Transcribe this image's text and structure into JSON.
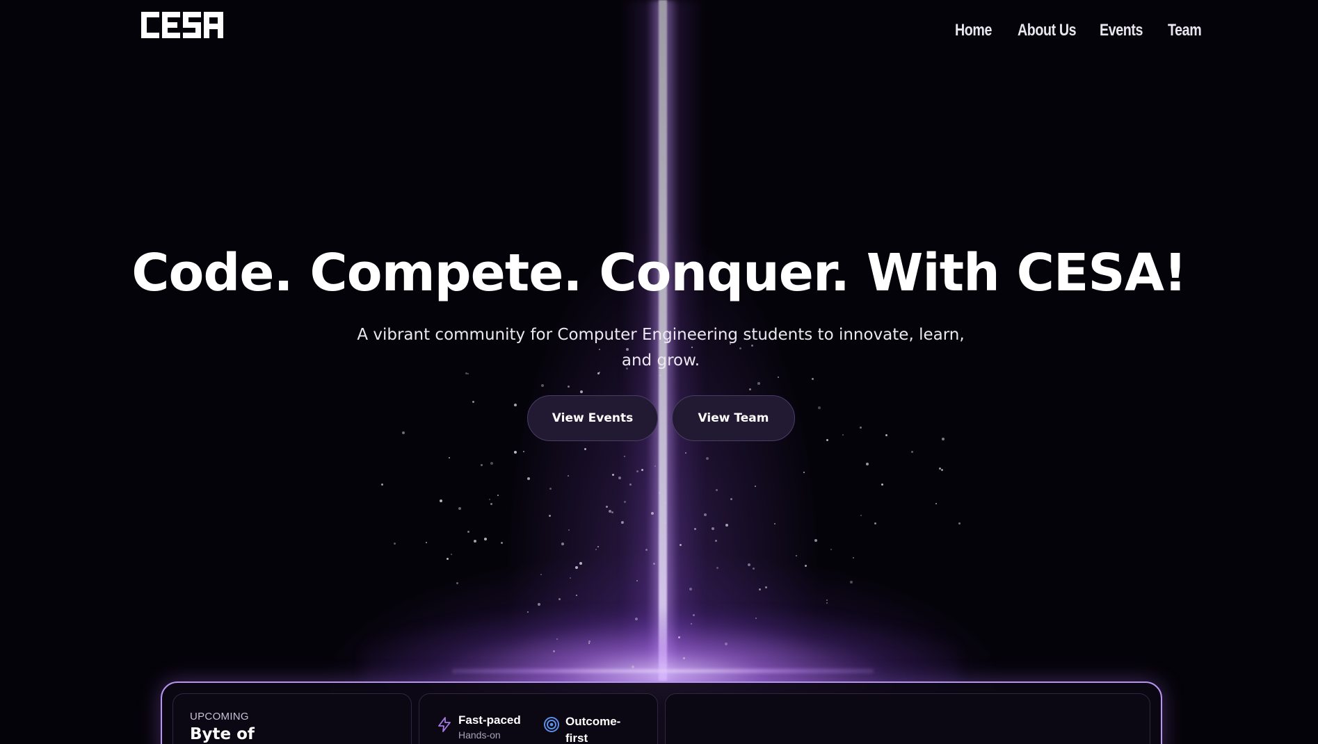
{
  "brand": {
    "logo_text": "CESA"
  },
  "nav": {
    "items": [
      {
        "label": "Home"
      },
      {
        "label": "About Us"
      },
      {
        "label": "Events"
      },
      {
        "label": "Team"
      }
    ]
  },
  "hero": {
    "title": "Code. Compete. Conquer. With CESA!",
    "subtitle": "A vibrant community for Computer Engineering students to innovate, learn, and grow.",
    "buttons": {
      "events_label": "View Events",
      "team_label": "View Team"
    }
  },
  "cards": {
    "upcoming": {
      "label": "UPCOMING",
      "title": "Byte of"
    },
    "features": [
      {
        "title": "Fast-paced",
        "subtitle": "Hands-on",
        "icon": "lightning-icon"
      },
      {
        "title": "Outcome-first",
        "subtitle": "",
        "icon": "target-icon"
      }
    ]
  },
  "colors": {
    "background": "#05030a",
    "beam_purple": "#9a5fd8",
    "panel_border": "#b894f2",
    "button_bg": "#221a33",
    "lightning_icon": "#a77ae8",
    "target_icon": "#5b8fe8"
  }
}
